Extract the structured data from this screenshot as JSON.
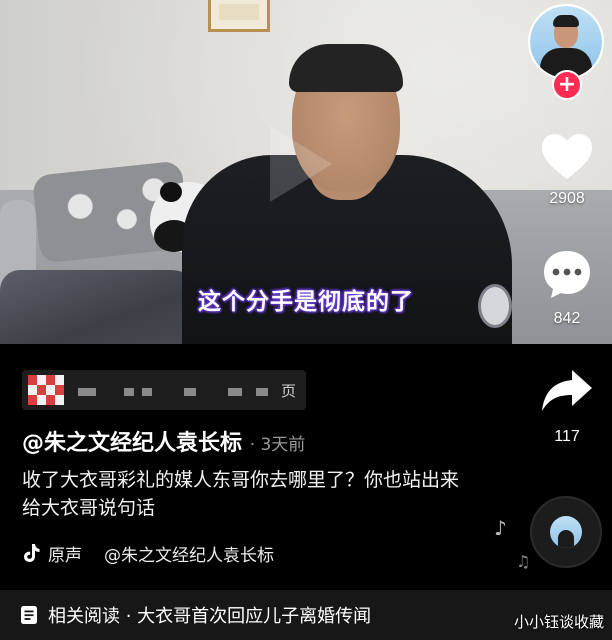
{
  "video": {
    "subtitle": "这个分手是彻底的了"
  },
  "sidebar": {
    "like_count": "2908",
    "comment_count": "842",
    "share_count": "117"
  },
  "info": {
    "mosaic_suffix": "页",
    "author": "@朱之文经纪人袁长标",
    "post_time": "· 3天前",
    "caption": "收了大衣哥彩礼的媒人东哥你去哪里了？你也站出来给大衣哥说句话",
    "music_label": "原声",
    "music_author": "@朱之文经纪人袁长标"
  },
  "related": {
    "text": "相关阅读 · 大衣哥首次回应儿子离婚传闻"
  },
  "watermark": "小小钰谈收藏",
  "icons": {
    "follow": "plus-icon",
    "like": "heart-icon",
    "comment": "comment-icon",
    "share": "share-arrow-icon",
    "music": "tiktok-note-icon",
    "related": "document-icon"
  },
  "colors": {
    "follow_button": "#fe2c55",
    "subtitle_glow": "#6a3fd8",
    "background": "#000000"
  }
}
